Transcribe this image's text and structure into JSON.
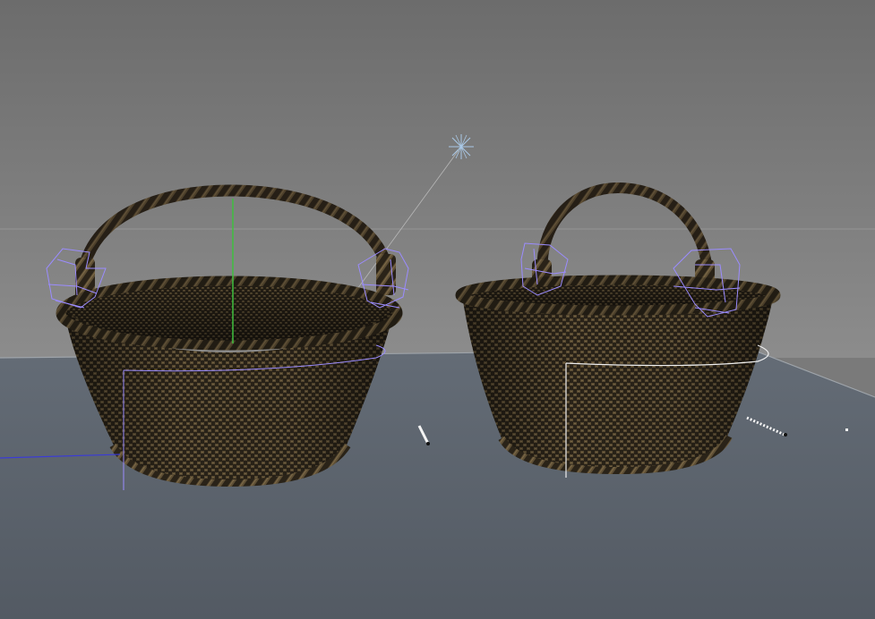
{
  "viewport": {
    "background_top": "#6d6d6d",
    "background_bottom": "#8a8a8a",
    "floor_color": "#5b636d",
    "horizon_color": "#9a9a9a"
  },
  "colors": {
    "wicker_dark": "#2a2318",
    "wicker_mid": "#4a3e2a",
    "wicker_light": "#6b5a3c",
    "selection_purple": "#9b8cff",
    "gizmo_white": "#f0f0f0",
    "axis_green": "#3fbf3f",
    "axis_blue": "#3b3bd6",
    "light_icon": "#a9c8e6"
  },
  "objects": [
    {
      "name": "basket-left",
      "selected": true
    },
    {
      "name": "basket-right",
      "selected": true
    }
  ],
  "icons": [
    "light-star-icon",
    "move-gizmo-icon",
    "pivot-icon"
  ]
}
